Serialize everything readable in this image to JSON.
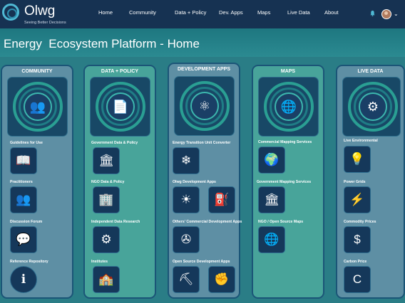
{
  "brand": {
    "name": "Olwg",
    "tagline": "Seeing Better Decisions"
  },
  "nav": {
    "home": "Home",
    "community": "Community",
    "data_policy": "Data + Policy",
    "dev_apps": "Dev. Apps",
    "maps": "Maps",
    "live_data": "Live Data",
    "about": "About",
    "bell_icon": "bell-icon",
    "user_avatar": "avatar",
    "menu_chevron": "chevron-down-icon"
  },
  "page": {
    "title": "Energy  Ecosystem Platform - Home"
  },
  "columns": {
    "community": {
      "title": "COMMUNITY",
      "items": [
        {
          "label": "Guidelines for Use",
          "icon": "book-icon"
        },
        {
          "label": "Practitioners",
          "icon": "people-icon"
        },
        {
          "label": "Discussion Forum",
          "icon": "chat-icon"
        },
        {
          "label": "Reference Repository",
          "icon": "info-icon"
        }
      ]
    },
    "data_policy": {
      "title": "DATA + POLICY",
      "items": [
        {
          "label": "Government Data & Policy",
          "icon": "government-building-icon"
        },
        {
          "label": "NGO Data & Policy",
          "icon": "ngo-building-icon"
        },
        {
          "label": "Independent Data Research",
          "icon": "research-icon"
        },
        {
          "label": "Institutes",
          "icon": "institute-icon"
        }
      ]
    },
    "dev_apps": {
      "title": "DEVELOPMENT APPS",
      "items": [
        {
          "label": "Energy Transition Unit Converter",
          "icon": "gears-icon"
        },
        {
          "label": "Olwg Development Apps",
          "icon": "solar-icon"
        },
        {
          "label": "Others' Commercial Development Apps",
          "icon": "wind-turbine-icon"
        },
        {
          "label": "Open Source Development Apps",
          "icon": "drill-rig-icon"
        }
      ]
    },
    "maps": {
      "title": "MAPS",
      "items": [
        {
          "label": "Commercial Mapping Services",
          "icon": "globe-stand-icon"
        },
        {
          "label": "Government Mapping Services",
          "icon": "capitol-icon"
        },
        {
          "label": "NGO / Open Source Maps",
          "icon": "globe-hands-icon"
        }
      ]
    },
    "live_data": {
      "title": "LIVE DATA",
      "items": [
        {
          "label": "Live Environmental",
          "icon": "lightbulb-icon"
        },
        {
          "label": "Power Grids",
          "icon": "lightning-icon"
        },
        {
          "label": "Commodity Prices",
          "icon": "price-icon"
        },
        {
          "label": "Carbon Price",
          "icon": "carbon-icon"
        }
      ]
    }
  },
  "colors": {
    "nav_bg": "#163252",
    "page_bg": "#2a7d86",
    "column_green": "#48a49a",
    "column_slate": "#5e8fa4",
    "tile_bg": "#15385a"
  }
}
